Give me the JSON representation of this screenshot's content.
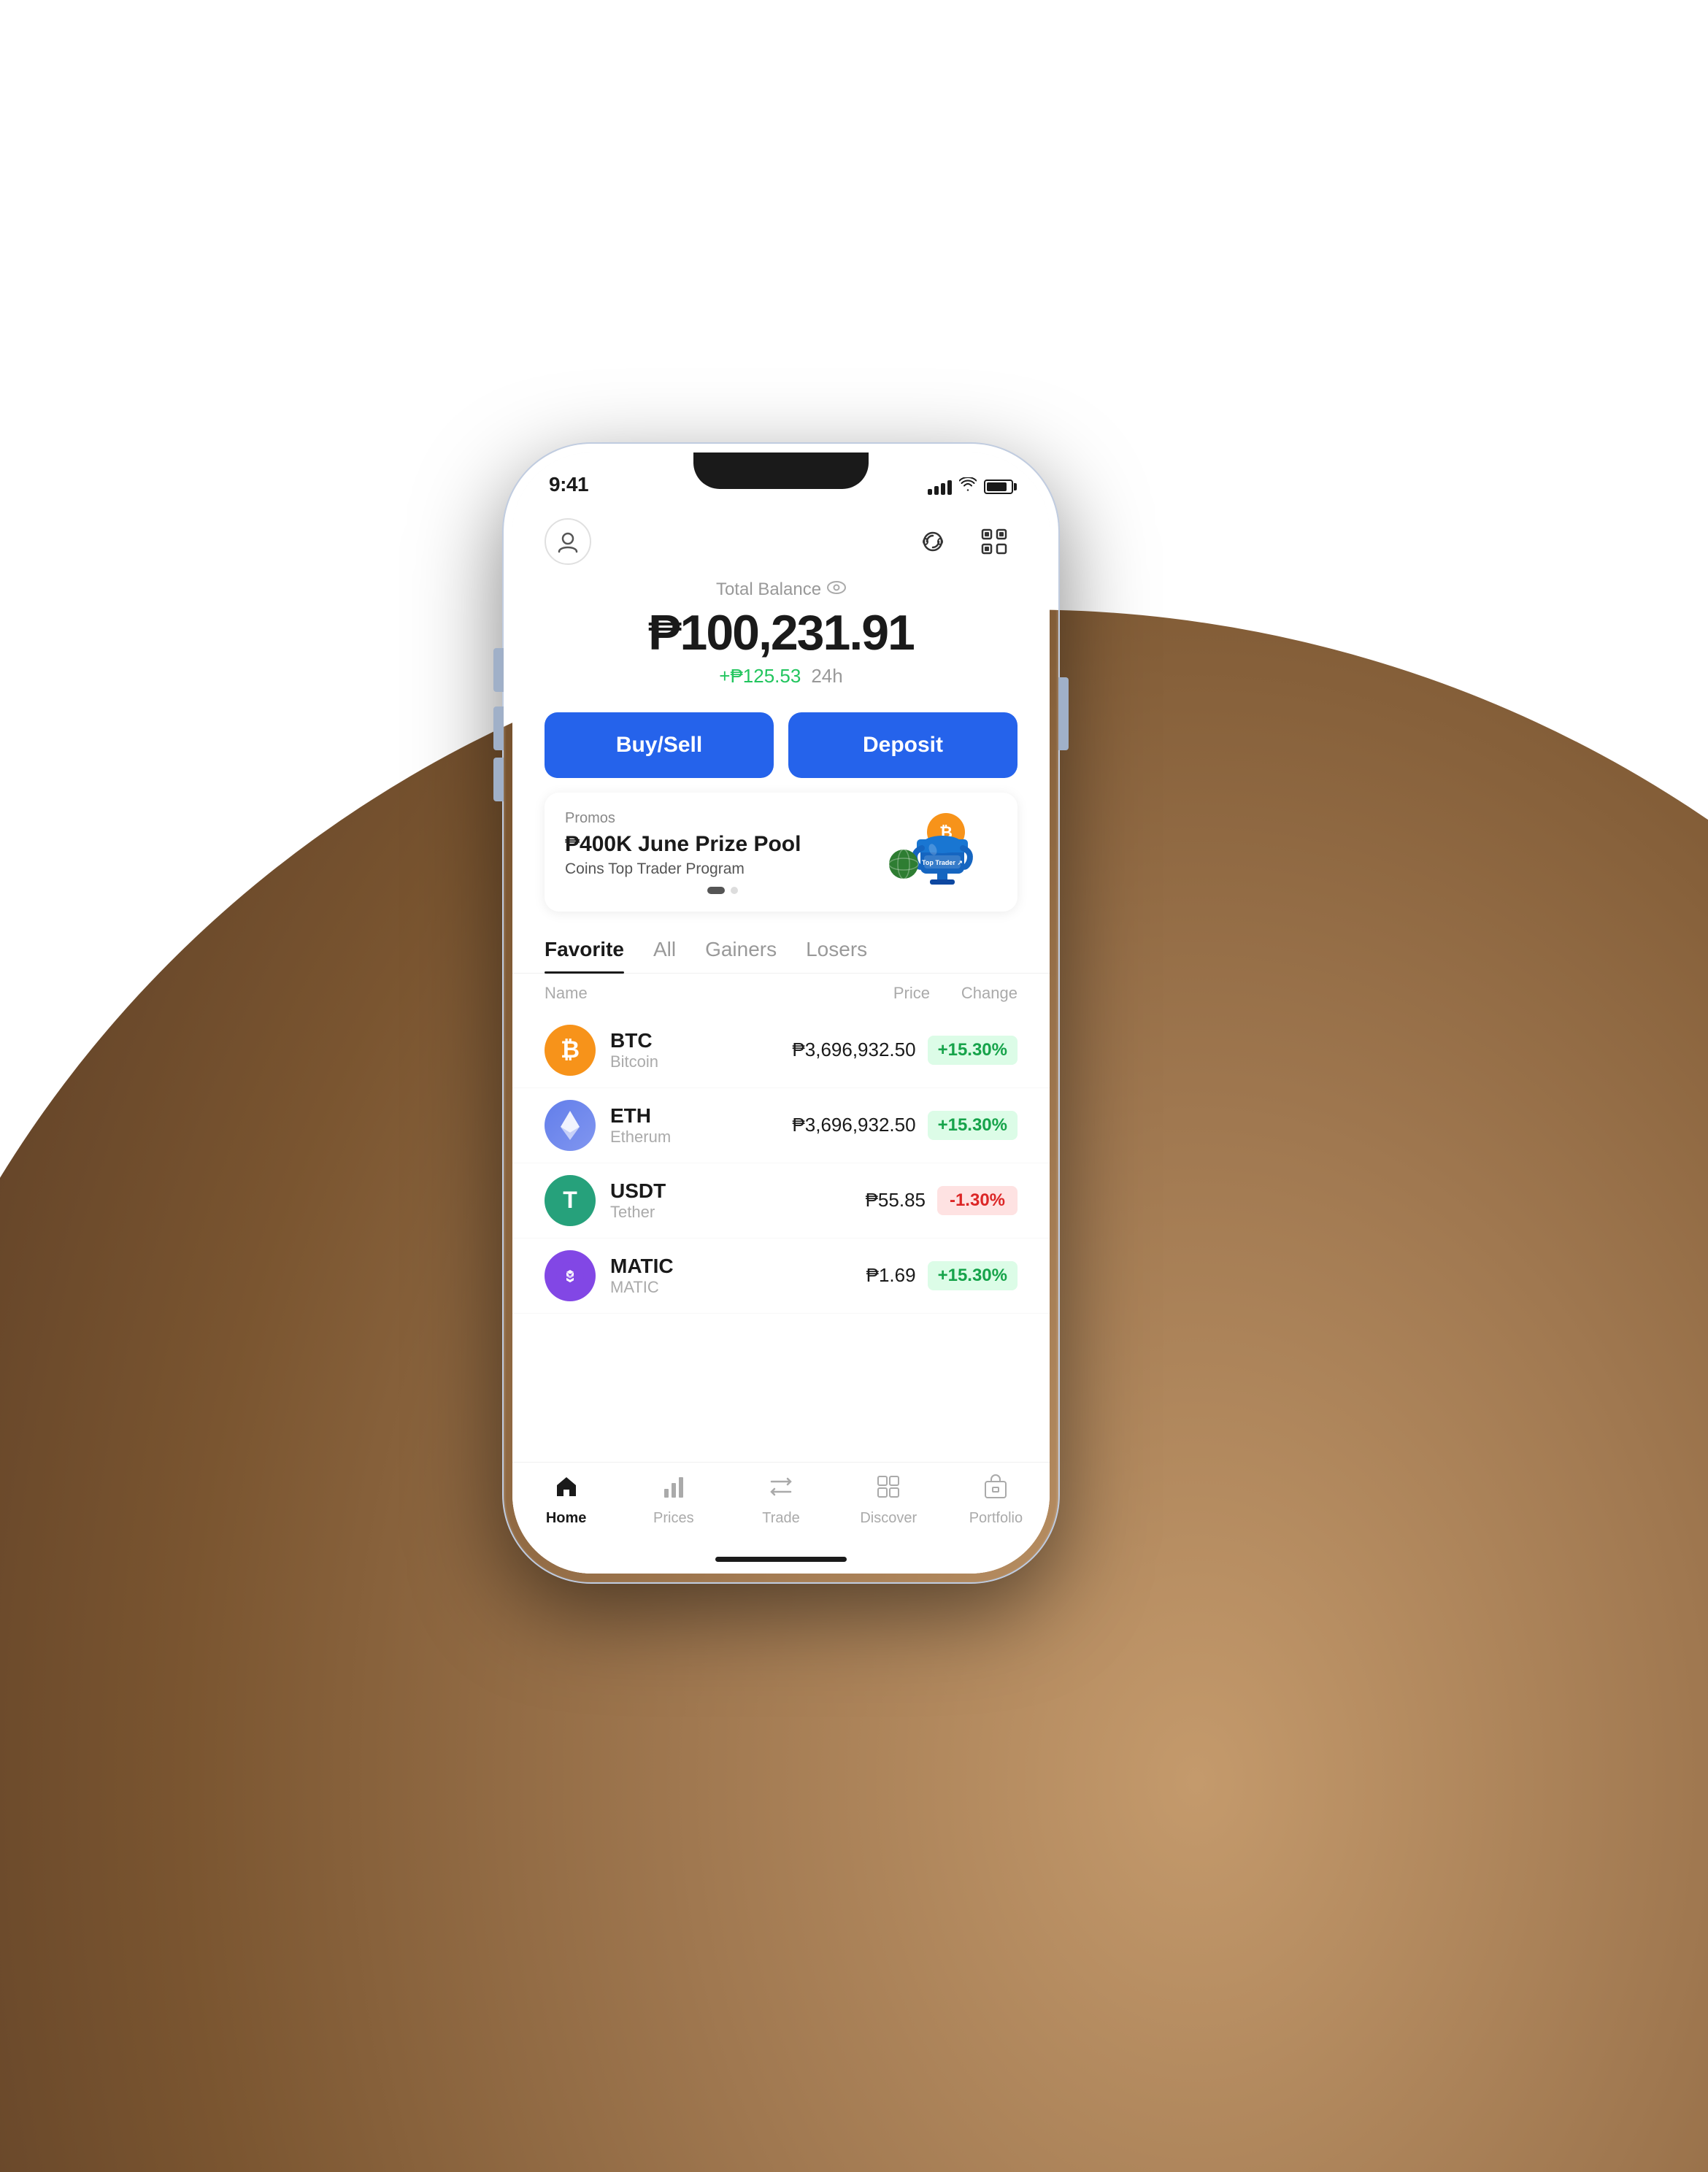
{
  "status_bar": {
    "time": "9:41"
  },
  "header": {
    "avatar_label": "👤",
    "support_label": "🎧",
    "scan_label": "⊞"
  },
  "balance": {
    "label": "Total Balance",
    "amount": "₱100,231.91",
    "change": "+₱125.53",
    "period": "24h"
  },
  "actions": {
    "buy_sell": "Buy/Sell",
    "deposit": "Deposit"
  },
  "promo": {
    "tag": "Promos",
    "title": "₱400K June Prize Pool",
    "subtitle": "Coins Top Trader Program",
    "badge": "Top Trader ↗"
  },
  "market": {
    "tabs": [
      "Favorite",
      "All",
      "Gainers",
      "Losers"
    ],
    "active_tab": "Favorite",
    "columns": {
      "name": "Name",
      "price": "Price",
      "change": "Change"
    },
    "coins": [
      {
        "symbol": "BTC",
        "name": "Bitcoin",
        "price": "₱3,696,932.50",
        "change": "+15.30%",
        "positive": true,
        "icon_type": "btc"
      },
      {
        "symbol": "ETH",
        "name": "Etherum",
        "price": "₱3,696,932.50",
        "change": "+15.30%",
        "positive": true,
        "icon_type": "eth"
      },
      {
        "symbol": "USDT",
        "name": "Tether",
        "price": "₱55.85",
        "change": "-1.30%",
        "positive": false,
        "icon_type": "usdt"
      },
      {
        "symbol": "MATIC",
        "name": "MATIC",
        "price": "₱1.69",
        "change": "+15.30%",
        "positive": true,
        "icon_type": "matic"
      }
    ]
  },
  "bottom_nav": {
    "items": [
      {
        "label": "Home",
        "icon": "🏠",
        "active": true
      },
      {
        "label": "Prices",
        "icon": "📊",
        "active": false
      },
      {
        "label": "Trade",
        "icon": "⇄",
        "active": false
      },
      {
        "label": "Discover",
        "icon": "⊞",
        "active": false
      },
      {
        "label": "Portfolio",
        "icon": "🗂",
        "active": false
      }
    ]
  }
}
